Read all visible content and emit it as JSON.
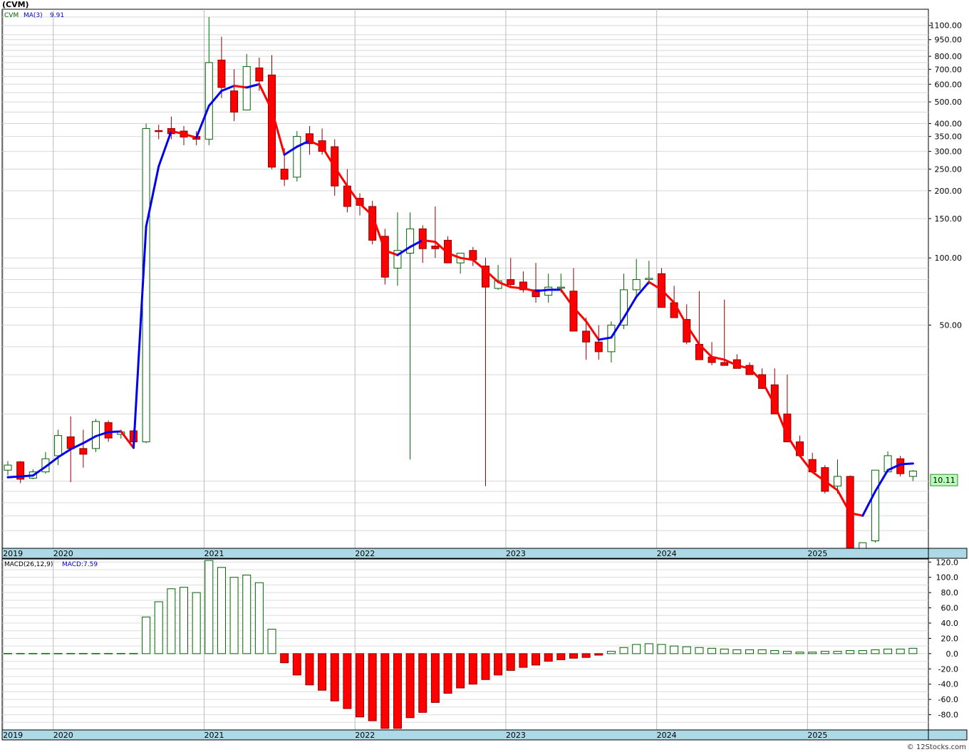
{
  "title": "(CVM)",
  "credit": "© 12Stocks.com",
  "colors": {
    "up": "#006400",
    "down": "#ff0000",
    "ma_up": "#0000ee",
    "ma_down": "#ff0000",
    "bg": "#ffffff",
    "axis_band": "#add8e6",
    "grid": "#bbbbbb",
    "label_box": "#b8ffb8"
  },
  "chart_data": [
    {
      "type": "candlestick",
      "scale": "log",
      "ylim": [
        5,
        1300
      ],
      "legend": {
        "symbol": "CVM",
        "ma_label": "MA(3)",
        "ma_value": "9.91"
      },
      "last_price_label": "10.11",
      "y_ticks": [
        "1100.00",
        "950.00",
        "800.00",
        "700.00",
        "600.00",
        "500.00",
        "400.00",
        "350.00",
        "300.00",
        "250.00",
        "200.00",
        "150.00",
        "100.00",
        "50.00"
      ],
      "y_tick_values": [
        1100,
        950,
        800,
        700,
        600,
        500,
        400,
        350,
        300,
        250,
        200,
        150,
        100,
        50
      ],
      "x_labels": [
        "2019",
        "2020",
        "2021",
        "2022",
        "2023",
        "2024",
        "2025"
      ],
      "x_label_index": [
        0,
        4,
        16,
        28,
        40,
        52,
        64
      ],
      "candles": [
        [
          11.2,
          12.3,
          10.6,
          11.8
        ],
        [
          12.2,
          12.3,
          9.8,
          10.2
        ],
        [
          10.3,
          11.3,
          10.2,
          11.0
        ],
        [
          11.0,
          13.5,
          10.8,
          12.6
        ],
        [
          13.0,
          17.0,
          11.8,
          16.0
        ],
        [
          15.8,
          19.5,
          9.9,
          14.0
        ],
        [
          14.0,
          17.0,
          11.5,
          13.2
        ],
        [
          14.0,
          19.0,
          13.5,
          18.5
        ],
        [
          18.3,
          18.7,
          15.0,
          15.6
        ],
        [
          16.2,
          17.0,
          15.5,
          16.6
        ],
        [
          16.8,
          17.0,
          14.8,
          15.0
        ],
        [
          15.0,
          400,
          14.8,
          380
        ],
        [
          372,
          395,
          340,
          370
        ],
        [
          380,
          430,
          340,
          360
        ],
        [
          370,
          390,
          320,
          348
        ],
        [
          350,
          370,
          320,
          340
        ],
        [
          340,
          1200,
          320,
          750
        ],
        [
          770,
          980,
          520,
          580
        ],
        [
          560,
          700,
          410,
          450
        ],
        [
          460,
          820,
          460,
          720
        ],
        [
          710,
          790,
          560,
          620
        ],
        [
          660,
          810,
          250,
          255
        ],
        [
          250,
          310,
          210,
          225
        ],
        [
          230,
          370,
          220,
          350
        ],
        [
          360,
          390,
          290,
          325
        ],
        [
          335,
          380,
          290,
          300
        ],
        [
          315,
          340,
          190,
          210
        ],
        [
          210,
          250,
          160,
          170
        ],
        [
          185,
          195,
          155,
          172
        ],
        [
          170,
          180,
          115,
          120
        ],
        [
          125,
          135,
          76,
          82
        ],
        [
          90,
          160,
          75,
          108
        ],
        [
          105,
          160,
          12.5,
          135
        ],
        [
          135,
          140,
          95,
          110
        ],
        [
          113,
          170,
          100,
          110
        ],
        [
          120,
          125,
          95,
          95
        ],
        [
          95,
          105,
          85,
          105
        ],
        [
          108,
          112,
          92,
          98
        ],
        [
          92,
          100,
          9.5,
          74
        ],
        [
          73,
          93,
          72,
          79
        ],
        [
          80,
          100,
          74,
          76
        ],
        [
          78,
          87,
          70,
          72
        ],
        [
          72,
          95,
          63,
          67
        ],
        [
          68,
          85,
          63,
          74
        ],
        [
          74,
          85,
          70,
          74
        ],
        [
          71,
          90,
          60,
          47
        ],
        [
          47,
          54,
          35,
          42
        ],
        [
          42,
          50,
          35,
          38
        ],
        [
          38,
          52,
          34,
          50
        ],
        [
          50,
          85,
          48,
          72
        ],
        [
          72,
          99,
          68,
          80
        ],
        [
          80,
          97,
          76,
          81
        ],
        [
          85,
          90,
          60,
          60
        ],
        [
          63,
          75,
          55,
          54
        ],
        [
          53,
          62,
          41,
          42
        ],
        [
          41,
          71,
          35,
          35
        ],
        [
          36,
          42,
          33,
          34
        ],
        [
          34,
          65,
          33,
          33
        ],
        [
          35,
          37,
          32,
          32
        ],
        [
          33,
          34,
          30,
          30
        ],
        [
          30,
          32,
          27,
          26
        ],
        [
          27,
          32,
          20,
          20
        ],
        [
          20,
          30,
          17,
          15
        ],
        [
          15,
          16,
          13.5,
          13.0
        ],
        [
          12.5,
          13.4,
          11.0,
          11.0
        ],
        [
          11.5,
          11.8,
          8.8,
          9.0
        ],
        [
          9.5,
          12.5,
          8.8,
          10.5
        ],
        [
          10.5,
          10.6,
          4.8,
          5.0
        ],
        [
          5.0,
          5.3,
          4.8,
          5.3
        ],
        [
          5.4,
          11.0,
          5.3,
          11.2
        ],
        [
          11.0,
          13.6,
          11.0,
          13.0
        ],
        [
          12.6,
          13.0,
          10.5,
          10.8
        ],
        [
          10.5,
          11.2,
          10.0,
          11.1
        ]
      ],
      "ma3": [
        10.4,
        10.5,
        10.6,
        11.6,
        12.8,
        13.9,
        14.8,
        15.9,
        16.6,
        16.7,
        14.1,
        138,
        257,
        370,
        359,
        346,
        480,
        560,
        590,
        580,
        600,
        460,
        290,
        315,
        335,
        315,
        255,
        210,
        175,
        155,
        108,
        103,
        112,
        120,
        118,
        105,
        100,
        98,
        88,
        78,
        74,
        73,
        71,
        72,
        72,
        60,
        52,
        43,
        44,
        54,
        67,
        78,
        72,
        63,
        50,
        41,
        36,
        35,
        33,
        32,
        28,
        22,
        16,
        13,
        11,
        10.0,
        9.1,
        7.2,
        7.0,
        9.0,
        11.2,
        11.9,
        12.0
      ]
    },
    {
      "type": "bar",
      "legend": {
        "label": "MACD(26,12,9)",
        "value_label": "MACD:7.59"
      },
      "ylim": [
        -100,
        124
      ],
      "y_ticks": [
        "120.0",
        "100.0",
        "80.0",
        "60.0",
        "40.0",
        "20.0",
        "0.0",
        "-20.0",
        "-40.0",
        "-60.0",
        "-80.0"
      ],
      "y_tick_values": [
        120,
        100,
        80,
        60,
        40,
        20,
        0,
        -20,
        -40,
        -60,
        -80
      ],
      "x_labels": [
        "2019",
        "2020",
        "2021",
        "2022",
        "2023",
        "2024",
        "2025"
      ],
      "values": [
        0,
        0,
        0,
        0,
        0,
        0,
        0,
        1,
        1,
        0.5,
        0.5,
        48,
        68,
        85,
        87,
        80,
        122,
        113,
        100,
        103,
        93,
        32,
        -12,
        -28,
        -41,
        -48,
        -62,
        -72,
        -83,
        -88,
        -98,
        -98,
        -84,
        -77,
        -64,
        -52,
        -45,
        -40,
        -34,
        -28,
        -22,
        -18,
        -15,
        -10,
        -8,
        -6,
        -5,
        -2,
        3,
        8,
        12,
        13,
        12,
        10,
        9,
        8,
        7,
        6,
        5,
        5,
        5,
        4,
        3,
        2,
        2,
        3,
        3,
        4,
        4,
        5,
        6,
        6,
        7
      ]
    }
  ]
}
